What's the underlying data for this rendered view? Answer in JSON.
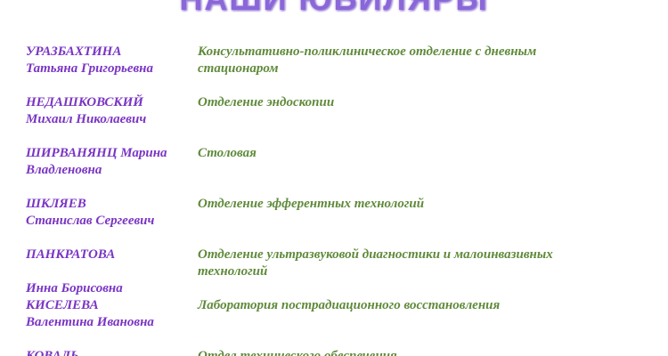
{
  "title": "НАШИ ЮБИЛЯРЫ",
  "entries": [
    {
      "name_lines": [
        "УРАЗБАХТИНА",
        "Татьяна Григорьевна"
      ],
      "dept_lines": [
        "Консультативно-поликлиническое отделение с дневным",
        "стационаром"
      ]
    },
    {
      "name_lines": [
        "НЕДАШКОВСКИЙ",
        "Михаил Николаевич"
      ],
      "dept_lines": [
        "Отделение эндоскопии"
      ]
    },
    {
      "name_lines": [
        "ШИРВАНЯНЦ Марина",
        "Владленовна"
      ],
      "dept_lines": [
        "Столовая"
      ]
    },
    {
      "name_lines": [
        "ШКЛЯЕВ",
        "Станислав Сергеевич"
      ],
      "dept_lines": [
        "Отделение эфферентных технологий"
      ]
    },
    {
      "name_lines": [
        "ПАНКРАТОВА"
      ],
      "dept_lines": [
        "Отделение ультразвуковой диагностики и малоинвазивных",
        "технологий"
      ]
    },
    {
      "name_lines": [
        "Инна Борисовна",
        "КИСЕЛЕВА",
        "Валентина Ивановна"
      ],
      "dept_lines": [
        "Лаборатория пострадиационного восстановления"
      ]
    },
    {
      "name_lines": [
        "КОВАЛЬ"
      ],
      "dept_lines": [
        "Отдел технического обеспечения"
      ]
    }
  ]
}
